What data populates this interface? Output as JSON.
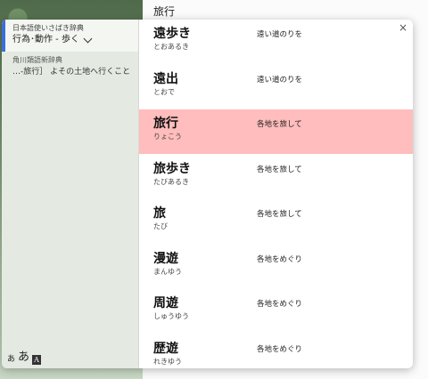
{
  "page": {
    "heading": "旅行"
  },
  "sources": [
    {
      "name": "日本語使いさばき辞典",
      "sub": "行為･動作 - 歩く"
    },
    {
      "name": "角川類語新辞典",
      "sub": "…-旅行］ よその土地へ行くこと"
    }
  ],
  "font_controls": {
    "small": "あ",
    "large": "あ",
    "mode": "A"
  },
  "close_label": "×",
  "selected_index": 2,
  "accent_color": "#3b6fd8",
  "highlight_color": "#ffbdbd",
  "entries": [
    {
      "word": "遠歩き",
      "reading": "とおあるき",
      "meaning": "遠い道のりを"
    },
    {
      "word": "遠出",
      "reading": "とおで",
      "meaning": "遠い道のりを"
    },
    {
      "word": "旅行",
      "reading": "りょこう",
      "meaning": "各地を旅して"
    },
    {
      "word": "旅歩き",
      "reading": "たびあるき",
      "meaning": "各地を旅して"
    },
    {
      "word": "旅",
      "reading": "たび",
      "meaning": "各地を旅して"
    },
    {
      "word": "漫遊",
      "reading": "まんゆう",
      "meaning": "各地をめぐり"
    },
    {
      "word": "周遊",
      "reading": "しゅうゆう",
      "meaning": "各地をめぐり"
    },
    {
      "word": "歴遊",
      "reading": "れきゆう",
      "meaning": "各地をめぐり"
    }
  ]
}
